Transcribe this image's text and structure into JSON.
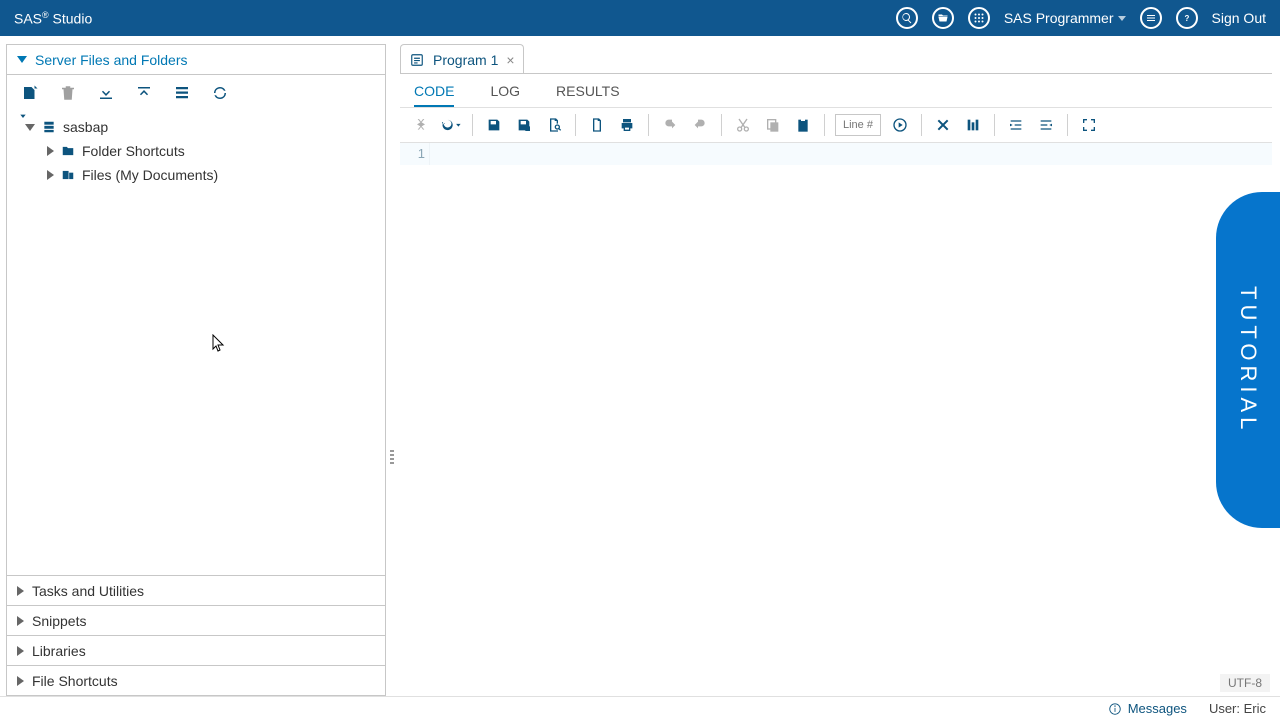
{
  "header": {
    "title_a": "SAS",
    "title_b": " Studio",
    "programmer": "SAS Programmer",
    "signout": "Sign Out"
  },
  "sidebar": {
    "panel_title": "Server Files and Folders",
    "tree": {
      "root": "sasbap",
      "children": [
        "Folder Shortcuts",
        "Files (My Documents)"
      ]
    },
    "collapsed": [
      "Tasks and Utilities",
      "Snippets",
      "Libraries",
      "File Shortcuts"
    ]
  },
  "tabs": {
    "program1": "Program 1"
  },
  "subtabs": {
    "code": "CODE",
    "log": "LOG",
    "results": "RESULTS"
  },
  "editor": {
    "line_placeholder": "Line #",
    "gutter": "1"
  },
  "tutorial": "TUTORIAL",
  "status": {
    "encoding": "UTF-8",
    "messages": "Messages",
    "user": "User: Eric"
  }
}
